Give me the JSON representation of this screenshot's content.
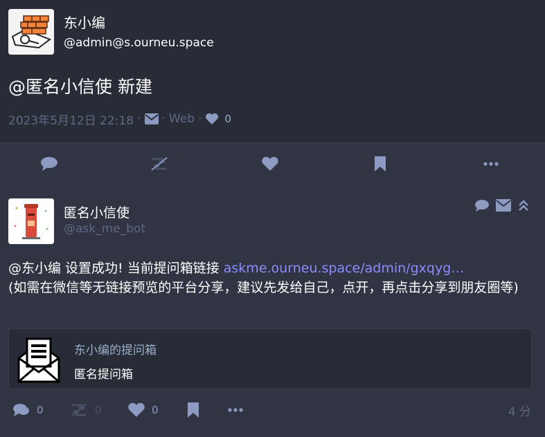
{
  "main_status": {
    "display_name": "东小编",
    "acct": "@admin@s.ourneu.space",
    "content": "@匿名小信使 新建",
    "timestamp": "2023年5月12日 22:18",
    "visibility_icon": "envelope-icon",
    "application": "Web",
    "favourites_count": "0",
    "separator": "·"
  },
  "action_bar": {
    "items": [
      "reply-icon",
      "boost-disabled-icon",
      "heart-icon",
      "bookmark-icon",
      "more-icon"
    ]
  },
  "reply": {
    "display_name": "匿名小信使",
    "acct": "@ask_me_bot",
    "content_mention": "@东小编",
    "content_text": " 设置成功! 当前提问箱链接 ",
    "content_link": "askme.ourneu.space/admin/gxqyg…",
    "content_text2": "(如需在微信等无链接预览的平台分享，建议先发给自己，点开，再点击分享到朋友圈等)",
    "card": {
      "title": "东小编的提问箱",
      "description": "匿名提问箱"
    },
    "counts": {
      "replies": "0",
      "boosts": "0",
      "favourites": "0"
    },
    "time_ago": "4 分"
  },
  "colors": {
    "background": "#282c37",
    "panel": "#313543",
    "muted": "#606984",
    "icon": "#8d9ac2",
    "link": "#8c8dff"
  }
}
